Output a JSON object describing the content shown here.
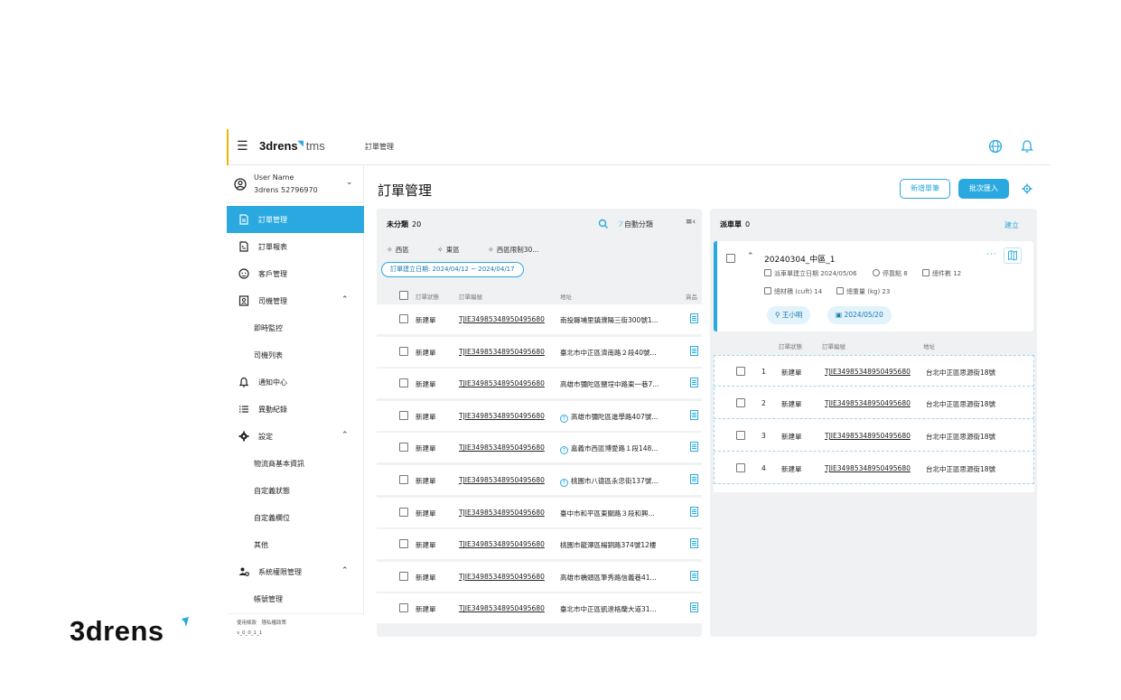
{
  "app": {
    "logo_text": "3drens",
    "logo_suffix": "tms",
    "breadcrumb": "訂單管理"
  },
  "user": {
    "name": "User Name",
    "account": "3drens 52796970"
  },
  "sidebar": {
    "items": [
      {
        "label": "訂單管理",
        "icon": "document-icon",
        "active": true
      },
      {
        "label": "訂單報表",
        "icon": "report-icon"
      },
      {
        "label": "客戶管理",
        "icon": "face-icon"
      },
      {
        "label": "司機管理",
        "icon": "id-badge-icon",
        "expanded": true
      },
      {
        "label": "即時監控",
        "sub": true
      },
      {
        "label": "司機列表",
        "sub": true
      },
      {
        "label": "通知中心",
        "icon": "bell-icon"
      },
      {
        "label": "異動紀錄",
        "icon": "list-icon"
      },
      {
        "label": "設定",
        "icon": "gear-icon",
        "expanded": true
      },
      {
        "label": "物流商基本資訊",
        "sub": true
      },
      {
        "label": "自定義狀態",
        "sub": true
      },
      {
        "label": "自定義欄位",
        "sub": true
      },
      {
        "label": "其他",
        "sub": true
      },
      {
        "label": "系統權限管理",
        "icon": "users-gear-icon",
        "expanded": true
      },
      {
        "label": "帳號管理",
        "sub": true
      }
    ],
    "footer_links": "使用條款　隱私權政策",
    "version": "v_0_0_1_1"
  },
  "main": {
    "title": "訂單管理",
    "new_order_label": "新增單筆",
    "batch_import_label": "批次匯入"
  },
  "unclassified": {
    "title": "未分類",
    "count": "20",
    "auto_label": "自動分類",
    "categories": [
      "西區",
      "東區",
      "西區限制30..."
    ],
    "date_filter": "訂單建立日期: 2024/04/12 ~ 2024/04/17",
    "columns": {
      "status": "訂單狀態",
      "number": "訂單編號",
      "address": "地址",
      "goods": "貨品"
    },
    "rows": [
      {
        "status": "新建單",
        "number": "TJIE34985348950495680",
        "address": "南投縣埔里鎮濮陽三街300號1...",
        "upload": false
      },
      {
        "status": "新建單",
        "number": "TJIE34985348950495680",
        "address": "臺北市中正區濟南路２段40號...",
        "upload": false
      },
      {
        "status": "新建單",
        "number": "TJIE34985348950495680",
        "address": "高雄市彌陀區鹽埕中路東一巷7...",
        "upload": false
      },
      {
        "status": "新建單",
        "number": "TJIE34985348950495680",
        "address": "高雄市彌陀區進學路407號...",
        "upload": true
      },
      {
        "status": "新建單",
        "number": "TJIE34985348950495680",
        "address": "嘉義市西區博愛路１段148...",
        "upload": true
      },
      {
        "status": "新建單",
        "number": "TJIE34985348950495680",
        "address": "桃園市八德區永忠街137號...",
        "upload": true
      },
      {
        "status": "新建單",
        "number": "TJIE34985348950495680",
        "address": "臺中市和平區東關路３段和興...",
        "upload": false
      },
      {
        "status": "新建單",
        "number": "TJIE34985348950495680",
        "address": "桃園市龍潭區楊銅路374號12樓",
        "upload": false
      },
      {
        "status": "新建單",
        "number": "TJIE34985348950495680",
        "address": "高雄市橋頭區筆秀路信義巷41...",
        "upload": false
      },
      {
        "status": "新建單",
        "number": "TJIE34985348950495680",
        "address": "臺北市中正區凱達格蘭大道31...",
        "upload": false
      }
    ]
  },
  "dispatch": {
    "title": "派車單",
    "count": "0",
    "build_label": "建立",
    "card": {
      "name": "20240304_中區_1",
      "created": "派車單建立日期 2024/05/06",
      "stops": "停靠點 8",
      "total_items": "總件數 12",
      "volume": "總材積 (cuft) 14",
      "weight": "總重量 (kg) 23",
      "driver": "王小明",
      "date": "2024/05/20"
    },
    "columns": {
      "status": "訂單狀態",
      "number": "訂單編號",
      "address": "地址"
    },
    "rows": [
      {
        "idx": "1",
        "status": "新建單",
        "number": "TJIE34985348950495680",
        "address": "台北中正區思源街18號"
      },
      {
        "idx": "2",
        "status": "新建單",
        "number": "TJIE34985348950495680",
        "address": "台北中正區思源街18號"
      },
      {
        "idx": "3",
        "status": "新建單",
        "number": "TJIE34985348950495680",
        "address": "台北中正區思源街18號"
      },
      {
        "idx": "4",
        "status": "新建單",
        "number": "TJIE34985348950495680",
        "address": "台北中正區思源街18號"
      }
    ]
  },
  "brand": {
    "text": "3drens"
  },
  "colors": {
    "accent": "#2aa9e0",
    "top_accent": "#f0b400"
  }
}
